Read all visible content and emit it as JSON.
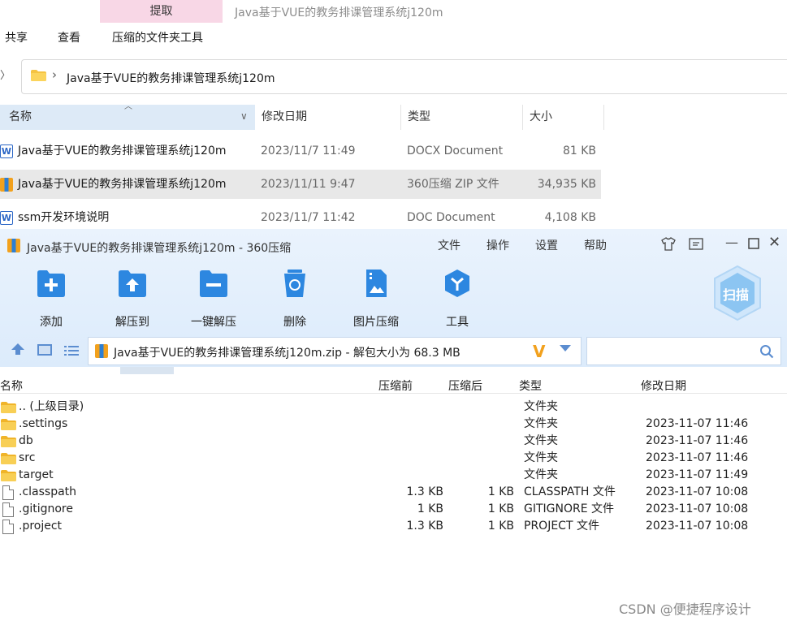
{
  "explorer": {
    "tab_extract": "提取",
    "window_title": "Java基于VUE的教务排课管理系统j120m",
    "ribbon": [
      "共享",
      "查看",
      "压缩的文件夹工具"
    ],
    "address_path": "Java基于VUE的教务排课管理系统j120m",
    "columns": {
      "name": "名称",
      "date": "修改日期",
      "type": "类型",
      "size": "大小"
    },
    "files": [
      {
        "name": "Java基于VUE的教务排课管理系统j120m",
        "date": "2023/11/7 11:49",
        "type": "DOCX Document",
        "size": "81 KB",
        "icon": "word-doc-icon"
      },
      {
        "name": "Java基于VUE的教务排课管理系统j120m",
        "date": "2023/11/11 9:47",
        "type": "360压缩 ZIP 文件",
        "size": "34,935 KB",
        "icon": "zip-archive-icon"
      },
      {
        "name": "ssm开发环境说明",
        "date": "2023/11/7 11:42",
        "type": "DOC Document",
        "size": "4,108 KB",
        "icon": "word-doc-icon"
      }
    ]
  },
  "zip": {
    "title": "Java基于VUE的教务排课管理系统j120m - 360压缩",
    "menu": [
      "文件",
      "操作",
      "设置",
      "帮助"
    ],
    "toolbar": [
      "添加",
      "解压到",
      "一键解压",
      "删除",
      "图片压缩",
      "工具"
    ],
    "scan_label": "扫描",
    "path_text": "Java基于VUE的教务排课管理系统j120m.zip - 解包大小为 68.3 MB",
    "search_placeholder": "",
    "columns": {
      "name": "名称",
      "pre": "压缩前",
      "post": "压缩后",
      "type": "类型",
      "date": "修改日期"
    },
    "rows": [
      {
        "name": ".. (上级目录)",
        "pre": "",
        "post": "",
        "type": "文件夹",
        "date": "",
        "kind": "folder"
      },
      {
        "name": ".settings",
        "pre": "",
        "post": "",
        "type": "文件夹",
        "date": "2023-11-07 11:46",
        "kind": "folder"
      },
      {
        "name": "db",
        "pre": "",
        "post": "",
        "type": "文件夹",
        "date": "2023-11-07 11:46",
        "kind": "folder"
      },
      {
        "name": "src",
        "pre": "",
        "post": "",
        "type": "文件夹",
        "date": "2023-11-07 11:46",
        "kind": "folder"
      },
      {
        "name": "target",
        "pre": "",
        "post": "",
        "type": "文件夹",
        "date": "2023-11-07 11:49",
        "kind": "folder"
      },
      {
        "name": ".classpath",
        "pre": "1.3 KB",
        "post": "1 KB",
        "type": "CLASSPATH 文件",
        "date": "2023-11-07 10:08",
        "kind": "file"
      },
      {
        "name": ".gitignore",
        "pre": "1 KB",
        "post": "1 KB",
        "type": "GITIGNORE 文件",
        "date": "2023-11-07 10:08",
        "kind": "file"
      },
      {
        "name": ".project",
        "pre": "1.3 KB",
        "post": "1 KB",
        "type": "PROJECT 文件",
        "date": "2023-11-07 10:08",
        "kind": "file"
      }
    ]
  },
  "watermark": "CSDN @便捷程序设计",
  "colors": {
    "accent_blue": "#2d87e0",
    "folder_yellow": "#f5c342",
    "selection": "#e8e8e8",
    "header_blue": "#ddeaf7"
  }
}
